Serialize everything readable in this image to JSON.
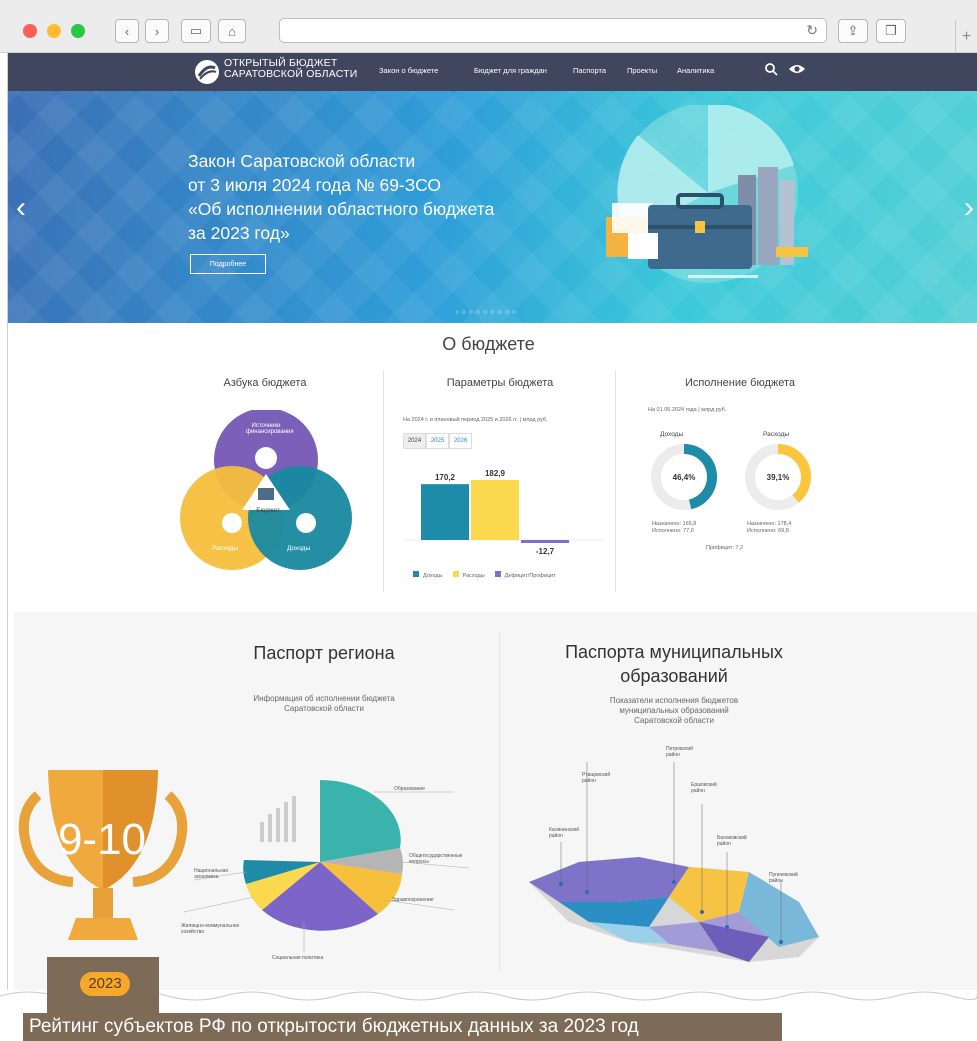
{
  "browser": {
    "url": ""
  },
  "site": {
    "logo_line1": "ОТКРЫТЫЙ БЮДЖЕТ",
    "logo_line2": "САРАТОВСКОЙ ОБЛАСТИ",
    "nav": [
      "Закон о бюджете",
      "Бюджет для граждан",
      "Паспорта",
      "Проекты",
      "Аналитика"
    ]
  },
  "hero": {
    "title": "Закон Саратовской области\nот 3 июля 2024 года № 69-ЗСО\n«Об исполнении областного бюджета\nза 2023 год»",
    "button": "Подробнее"
  },
  "about": {
    "title": "О бюджете",
    "abc": {
      "title": "Азбука бюджета",
      "top": "Источники\nфинансирования",
      "center": "Бюджет",
      "left": "Расходы",
      "right": "Доходы"
    },
    "params": {
      "title": "Параметры бюджета",
      "note": "На 2024 г. и плановый период 2025 и 2026 гг. | млрд руб.",
      "years": [
        "2024",
        "2025",
        "2026"
      ],
      "legend": [
        "Доходы",
        "Расходы",
        "Дефицит/Профицит"
      ]
    },
    "exec": {
      "title": "Исполнение бюджета",
      "note": "На 01.06.2024 года | млрд руб.",
      "income_label": "Доходы",
      "income_pct": "46,4%",
      "income_assigned": "Назначено: 165,8",
      "income_done": "Исполнено: 77,0",
      "expense_label": "Расходы",
      "expense_pct": "39,1%",
      "expense_assigned": "Назначено: 178,4",
      "expense_done": "Исполнено: 69,8",
      "proficit": "Профицит: 7,2"
    }
  },
  "chart_data": {
    "type": "bar",
    "categories": [
      "Доходы",
      "Расходы",
      "Дефицит/Профицит"
    ],
    "values": [
      170.2,
      182.9,
      -12.7
    ],
    "labels": [
      "170,2",
      "182,9",
      "-12,7"
    ],
    "colors": [
      "#1e8ca8",
      "#fbd94e",
      "#7d6cd1"
    ],
    "title": "Параметры бюджета"
  },
  "exec_data": {
    "income_pct": 46.4,
    "expense_pct": 39.1,
    "income_color": "#1e8ca8",
    "expense_color": "#fbc53c"
  },
  "passport": {
    "title": "Паспорт региона",
    "sub": "Информация об исполнении бюджета\nСаратовской области",
    "labels": [
      "Образование",
      "Общегосударственные\nвопросы",
      "Здравоохранение",
      "Социальная политика",
      "Жилищно-коммунальное\nхозяйство",
      "Национальная\nэкономика"
    ]
  },
  "municipal": {
    "title1": "Паспорта муниципальных",
    "title2": "образований",
    "sub": "Показатели исполнения бюджетов\nмуниципальных образований\nСаратовской области",
    "labels": [
      "Ртищевский\nрайон",
      "Петровский\nрайон",
      "Ершовский\nрайон",
      "Калининский\nрайон",
      "Балаковский\nрайон",
      "Пугачевский\nрайон"
    ]
  },
  "badge": {
    "rank": "9-10",
    "year": "2023",
    "caption": "Рейтинг субъектов РФ по открытости бюджетных данных за 2023 год"
  }
}
